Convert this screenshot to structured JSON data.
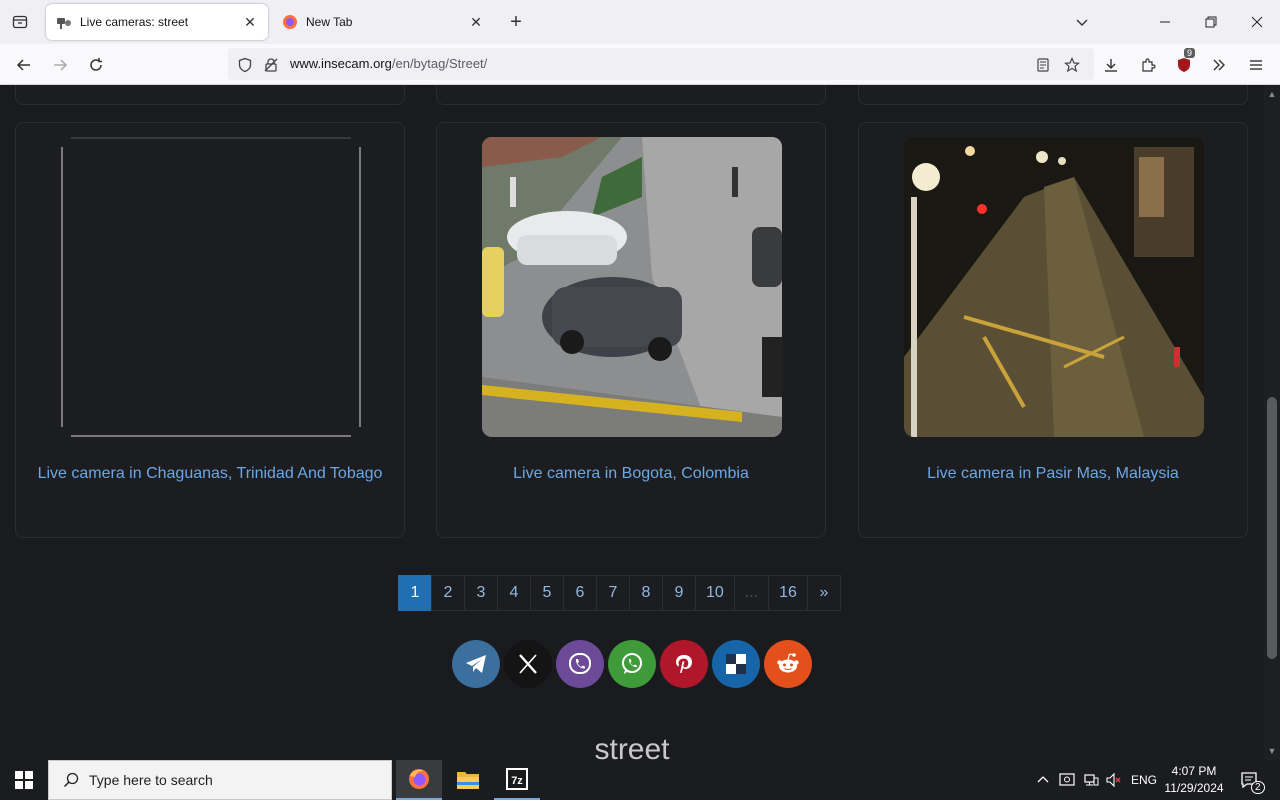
{
  "browser": {
    "tabs": [
      {
        "label": "Live cameras: street",
        "active": true
      },
      {
        "label": "New Tab",
        "active": false
      }
    ],
    "url": {
      "host": "www.insecam.org",
      "path": "/en/bytag/Street/"
    },
    "extension_badge": "9"
  },
  "cameras": [
    {
      "title": "Live camera in Chaguanas, Trinidad And Tobago",
      "image": "blank"
    },
    {
      "title": "Live camera in Bogota, Colombia",
      "image": "street-day"
    },
    {
      "title": "Live camera in Pasir Mas, Malaysia",
      "image": "street-night"
    }
  ],
  "pagination": {
    "pages": [
      "1",
      "2",
      "3",
      "4",
      "5",
      "6",
      "7",
      "8",
      "9",
      "10",
      "...",
      "16",
      "»"
    ],
    "current": "1"
  },
  "share_buttons": [
    {
      "name": "telegram",
      "color": "#3b6f9e"
    },
    {
      "name": "x",
      "color": "#141414"
    },
    {
      "name": "viber",
      "color": "#6c4a97"
    },
    {
      "name": "whatsapp",
      "color": "#3f9a3a"
    },
    {
      "name": "pinterest",
      "color": "#b0172b"
    },
    {
      "name": "delicious",
      "color": "#1565a8"
    },
    {
      "name": "reddit",
      "color": "#e3501c"
    }
  ],
  "footer_tag": "street",
  "taskbar": {
    "search_placeholder": "Type here to search",
    "language": "ENG",
    "time": "4:07 PM",
    "date": "11/29/2024",
    "notifications": "2"
  }
}
